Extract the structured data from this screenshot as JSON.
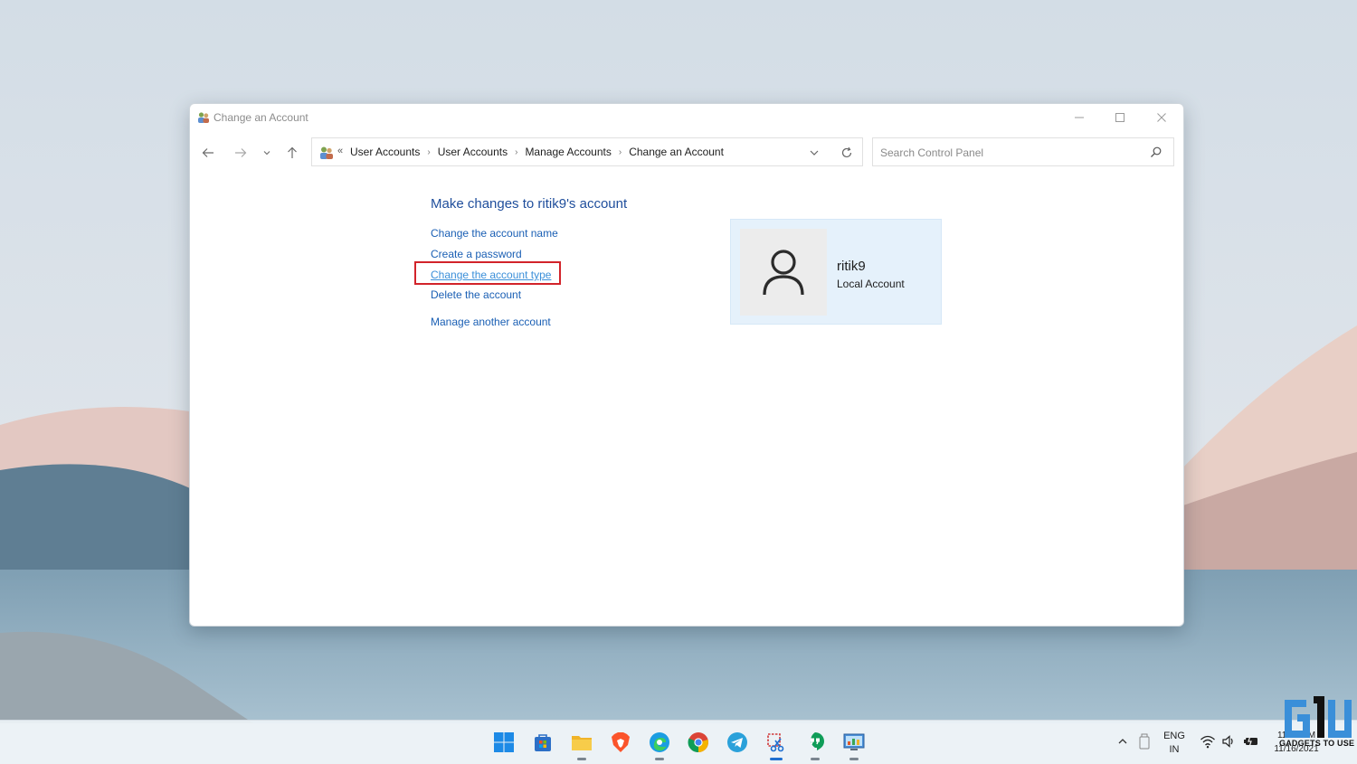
{
  "window": {
    "title": "Change an Account",
    "controls": {
      "minimize": "minimize-icon",
      "maximize": "maximize-icon",
      "close": "close-icon"
    }
  },
  "address_bar": {
    "overflow": "«",
    "breadcrumbs": [
      "User Accounts",
      "User Accounts",
      "Manage Accounts",
      "Change an Account"
    ]
  },
  "search": {
    "placeholder": "Search Control Panel"
  },
  "content": {
    "heading": "Make changes to ritik9's account",
    "tasks": {
      "change_name": "Change the account name",
      "create_password": "Create a password",
      "change_type": "Change the account type",
      "delete": "Delete the account",
      "manage_another": "Manage another account"
    },
    "highlighted_task": "change_type",
    "account": {
      "name": "ritik9",
      "type": "Local Account"
    }
  },
  "taskbar": {
    "apps": [
      "start",
      "store",
      "file-explorer",
      "brave",
      "edge",
      "chrome",
      "telegram",
      "snipping-tool",
      "hangouts",
      "control-panel"
    ],
    "active_app": "snipping-tool",
    "language": {
      "line1": "ENG",
      "line2": "IN"
    },
    "clock": {
      "time": "11:56 PM",
      "date": "11/16/2021"
    }
  },
  "watermark": {
    "text": "GADGETS TO USE"
  },
  "colors": {
    "link": "#1a5fb4",
    "heading": "#1f4e9c",
    "highlight_box": "#d2232a",
    "account_tile": "#e5f1fb"
  }
}
